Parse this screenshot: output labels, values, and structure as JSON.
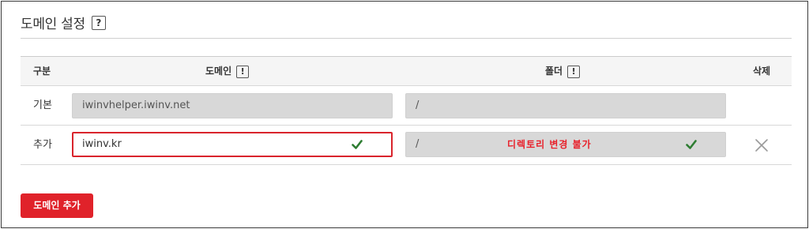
{
  "header": {
    "title": "도메인 설정",
    "help": "?"
  },
  "table": {
    "columns": {
      "type": "구분",
      "domain": "도메인",
      "folder": "폴더",
      "delete": "삭제"
    },
    "hint": "!",
    "rows": [
      {
        "type": "기본",
        "domain": "iwinvhelper.iwinv.net",
        "folder": "/"
      },
      {
        "type": "추가",
        "domain": "iwinv.kr",
        "folder": "/",
        "folder_note": "디렉토리 변경 불가"
      }
    ]
  },
  "actions": {
    "add_domain": "도메인 추가"
  },
  "colors": {
    "accent": "#e0222a",
    "check": "#2e7d32",
    "field_bg": "#d8d8d8"
  },
  "icons": {
    "help": "question-icon",
    "hint": "exclamation-icon",
    "valid": "check-icon",
    "delete": "close-icon"
  }
}
